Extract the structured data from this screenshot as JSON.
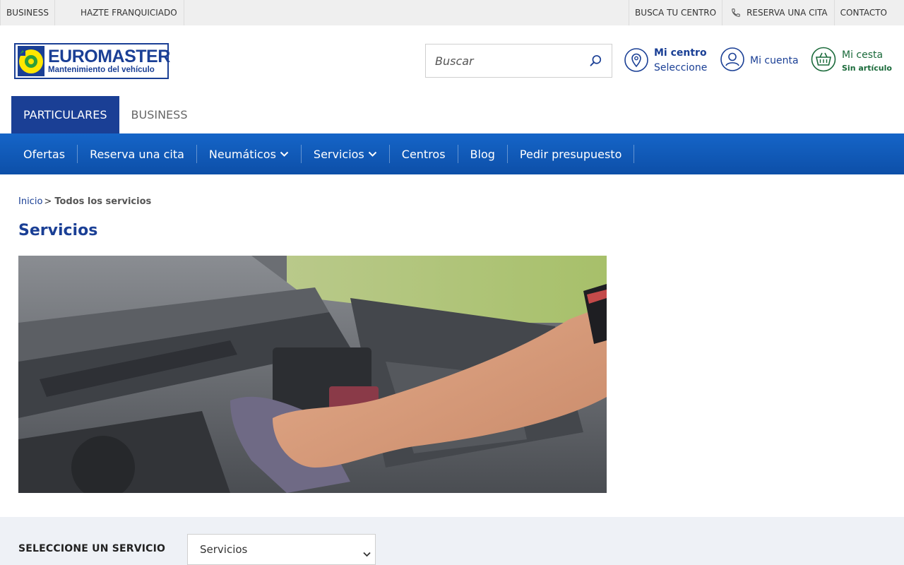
{
  "topbar": {
    "left_links": [
      "BUSINESS",
      "HAZTE FRANQUICIADO"
    ],
    "right_links": {
      "find_center": "BUSCA TU CENTRO",
      "book": "RESERVA UNA CITA",
      "contact": "CONTACTO"
    }
  },
  "logo": {
    "name": "EUROMASTER",
    "tagline": "Mantenimiento del vehículo"
  },
  "search": {
    "placeholder": "Buscar"
  },
  "header_items": {
    "centro": {
      "line1": "Mi centro",
      "line2": "Seleccione"
    },
    "cuenta": {
      "line1": "Mi cuenta"
    },
    "cesta": {
      "line1": "Mi cesta",
      "line2": "Sin artículo"
    }
  },
  "segment_tabs": [
    {
      "label": "PARTICULARES",
      "active": true
    },
    {
      "label": "BUSINESS",
      "active": false
    }
  ],
  "main_nav": [
    {
      "label": "Ofertas",
      "dropdown": false
    },
    {
      "label": "Reserva una cita",
      "dropdown": false
    },
    {
      "label": "Neumáticos",
      "dropdown": true
    },
    {
      "label": "Servicios",
      "dropdown": true
    },
    {
      "label": "Centros",
      "dropdown": false
    },
    {
      "label": "Blog",
      "dropdown": false
    },
    {
      "label": "Pedir presupuesto",
      "dropdown": false
    }
  ],
  "breadcrumb": {
    "home": "Inicio",
    "separator": ">",
    "current": "Todos los servicios"
  },
  "page": {
    "title": "Servicios"
  },
  "service_selector": {
    "label": "SELECCIONE UN SERVICIO",
    "selected": "Servicios"
  },
  "colors": {
    "brand_blue": "#1a3f95",
    "nav_blue": "#1565c8",
    "basket_green": "#1a6a3a",
    "band_gray": "#eef1f6"
  }
}
